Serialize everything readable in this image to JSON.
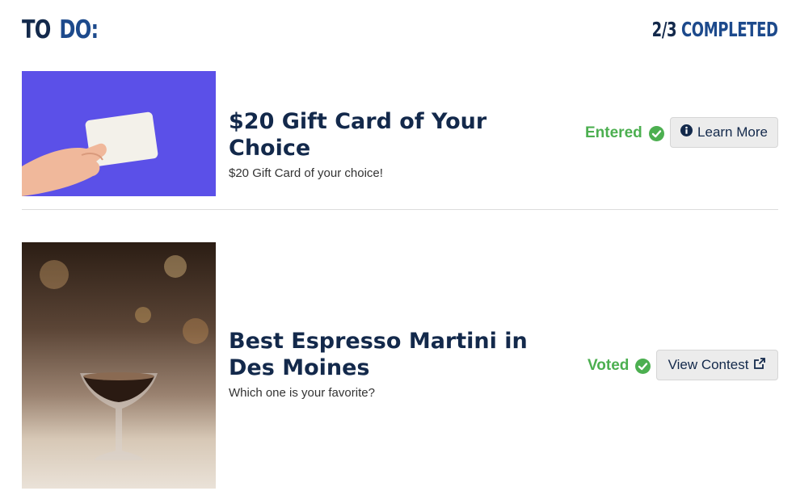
{
  "header": {
    "title_word1": "TO",
    "title_word2": "DO:",
    "progress_fraction": "2/3",
    "progress_word": "COMPLETED"
  },
  "items": [
    {
      "title": "$20 Gift Card of Your Choice",
      "description": "$20 Gift Card of your choice!",
      "status": "Entered",
      "button_label": "Learn More",
      "button_icon": "info-circle-icon",
      "image": "hand-holding-blank-card-photo"
    },
    {
      "title": "Best Espresso Martini in Des Moines",
      "description": "Which one is your favorite?",
      "status": "Voted",
      "button_label": "View Contest",
      "button_icon": "external-link-icon",
      "image": "espresso-martini-glass-photo"
    }
  ],
  "colors": {
    "navy": "#13294b",
    "blue": "#1d4a8c",
    "status_green": "#4caf50"
  }
}
